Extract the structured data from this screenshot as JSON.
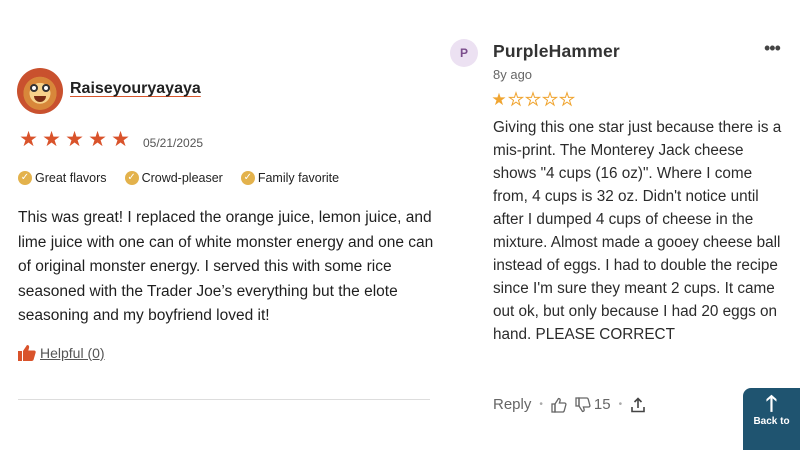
{
  "left_review": {
    "username": "Raiseyouryayaya",
    "rating": 5,
    "date": "05/21/2025",
    "tags": [
      "Great flavors",
      "Crowd-pleaser",
      "Family favorite"
    ],
    "body": "This was great! I replaced the orange juice, lemon juice, and lime juice with one can of white monster energy and one can of original monster energy. I served this with some rice seasoned with the Trader Joe’s everything but the elote seasoning and my boyfriend loved it!",
    "helpful_label": "Helpful (0)"
  },
  "right_review": {
    "avatar_initial": "P",
    "username": "PurpleHammer",
    "time_ago": "8y ago",
    "rating": 1,
    "rating_max": 5,
    "body": "Giving this one star just because there is a mis-print.  The Monterey Jack cheese shows \"4 cups (16 oz)\". Where I come from, 4 cups is 32 oz. Didn't notice until after I dumped 4 cups of cheese in the mixture. Almost made a gooey cheese ball instead of eggs.  I had to double the recipe since I'm sure they meant 2 cups.  It came out ok, but only because I had 20 eggs on hand. PLEASE CORRECT",
    "reply_label": "Reply",
    "dislike_count": "15",
    "menu_icon": "•••"
  },
  "back_to_top": {
    "arrow": "🡑",
    "label": "Back to"
  },
  "colors": {
    "accent_red": "#d9532b",
    "star_gold": "#f0a531",
    "tag_check": "#e3b24c",
    "back_to_bg": "#1f5470"
  }
}
